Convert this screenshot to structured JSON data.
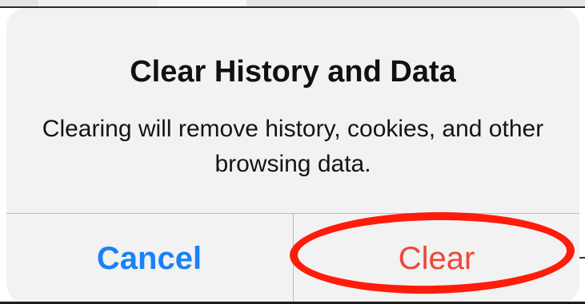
{
  "alert": {
    "title": "Clear History and Data",
    "message": "Clearing will remove history, cookies, and other browsing data.",
    "buttons": {
      "cancel_label": "Cancel",
      "clear_label": "Clear"
    }
  },
  "colors": {
    "cancel": "#1a82f7",
    "destructive": "#f24536",
    "annotation": "#ff1c0a",
    "alert_background": "#f2f2f2"
  }
}
